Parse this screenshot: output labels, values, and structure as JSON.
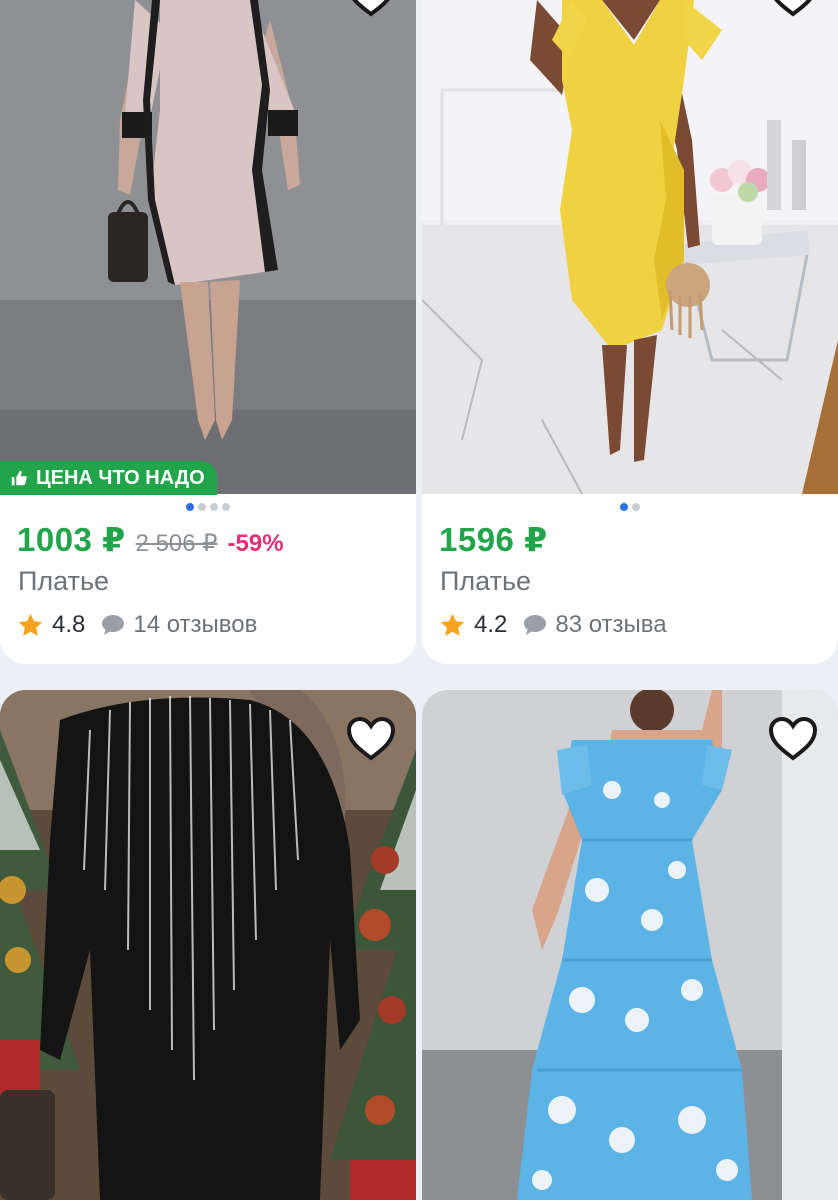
{
  "products": [
    {
      "price": "1003 ₽",
      "old_price": "2 506 ₽",
      "discount": "-59%",
      "title": "Платье",
      "rating": "4.8",
      "reviews": "14 отзывов",
      "badge": "ЦЕНА ЧТО НАДО",
      "image_dots": 4,
      "active_dot": 0
    },
    {
      "price": "1596 ₽",
      "title": "Платье",
      "rating": "4.2",
      "reviews": "83 отзыва",
      "image_dots": 2,
      "active_dot": 0
    },
    {
      "favorite": false
    },
    {
      "favorite": false
    }
  ],
  "colors": {
    "price_green": "#22a54a",
    "discount_pink": "#e0307a",
    "badge_green": "#22a54a",
    "star": "#f6a21c",
    "dot_active": "#2f6fe4"
  },
  "icons": {
    "favorite": "heart-outline-icon",
    "badge": "thumbs-up-icon",
    "rating": "star-icon",
    "reviews": "speech-bubble-icon"
  }
}
